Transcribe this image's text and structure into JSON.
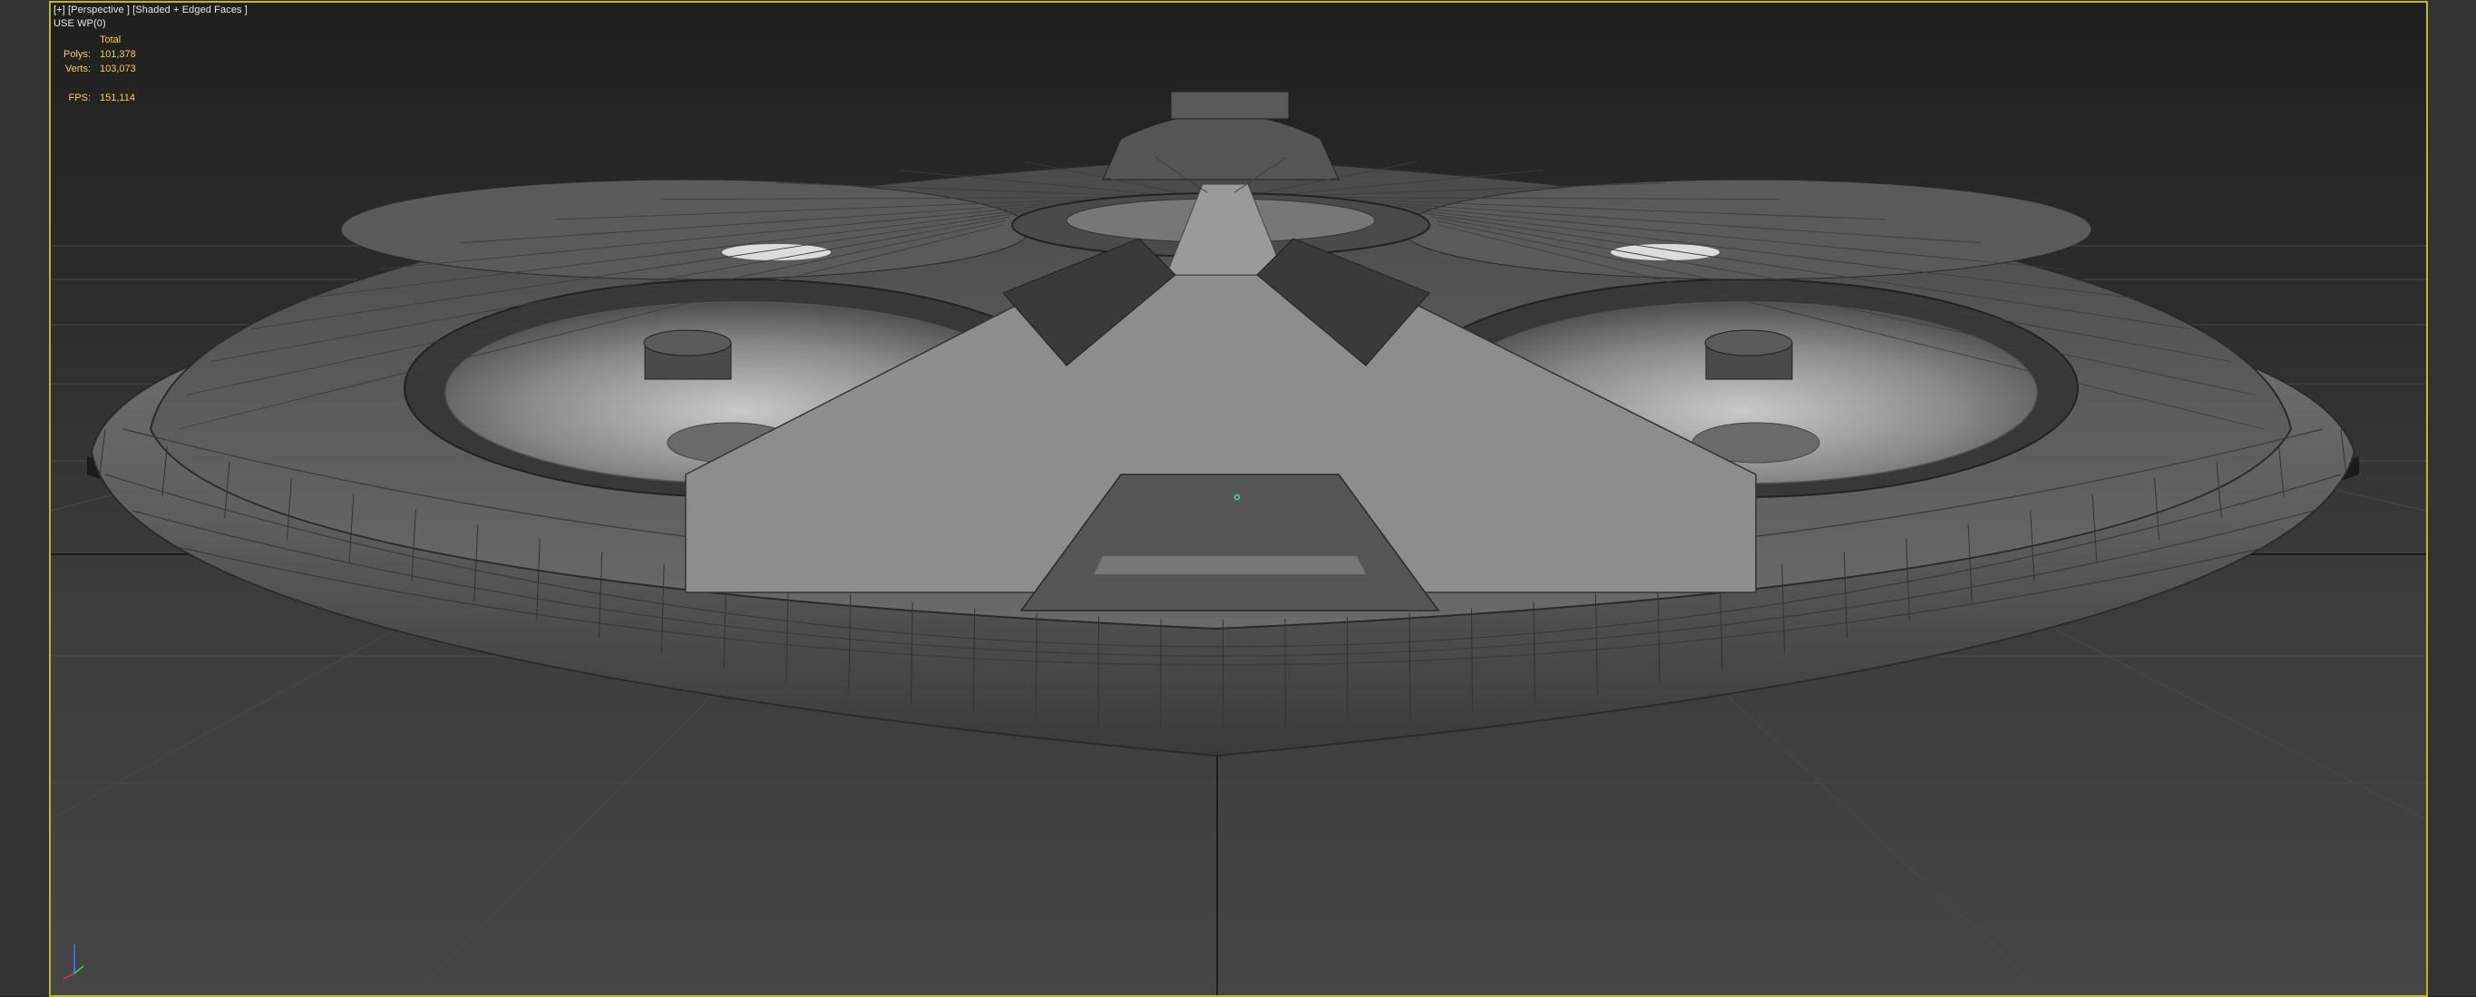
{
  "viewport": {
    "label_plus": "[+]",
    "label_view": "[Perspective ]",
    "label_shading": "[Shaded + Edged Faces ]",
    "label_wp": "USE WP(0)"
  },
  "stats": {
    "header": "Total",
    "polys_label": "Polys:",
    "polys_value": "101,378",
    "verts_label": "Verts:",
    "verts_value": "103,073",
    "fps_label": "FPS:",
    "fps_value": "151,114"
  },
  "colors": {
    "viewport_border": "#b9b92a",
    "stats_text": "#ffcf3b",
    "background": "#2b2b2b",
    "mesh": "#7a7a7a"
  },
  "icons": {
    "viewcube": "viewcube-icon",
    "axis_tripod": "axis-tripod-icon",
    "pivot": "pivot-marker-icon"
  }
}
